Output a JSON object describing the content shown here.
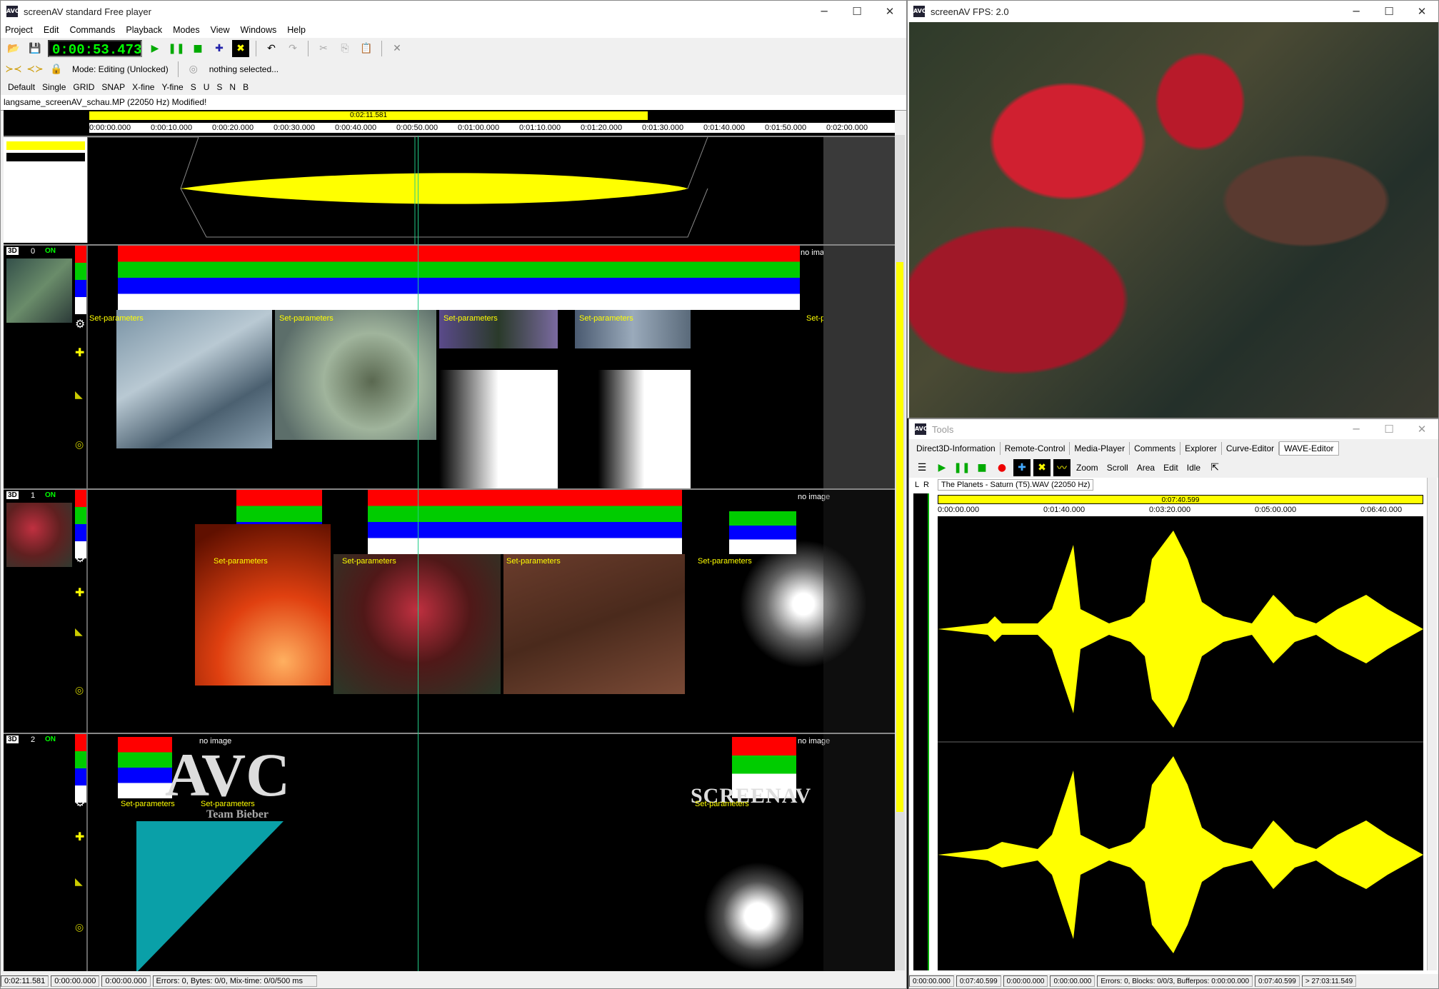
{
  "main": {
    "title": "screenAV standard Free player",
    "menu": [
      "Project",
      "Edit",
      "Commands",
      "Playback",
      "Modes",
      "View",
      "Windows",
      "Help"
    ],
    "timecode": "0:00:53.473",
    "mode": "Mode: Editing (Unlocked)",
    "selection": "nothing selected...",
    "opts": [
      "Default",
      "Single",
      "GRID",
      "SNAP",
      "X-fine",
      "Y-fine",
      "S",
      "U",
      "S",
      "N",
      "B"
    ],
    "file_tab": "langsame_screenAV_schau.MP  (22050 Hz) Modified!",
    "range_label": "0:02:11.581",
    "ruler": [
      "0:00:00.000",
      "0:00:10.000",
      "0:00:20.000",
      "0:00:30.000",
      "0:00:40.000",
      "0:00:50.000",
      "0:01:00.000",
      "0:01:10.000",
      "0:01:20.000",
      "0:01:30.000",
      "0:01:40.000",
      "0:01:50.000",
      "0:02:00.000"
    ],
    "lanes": [
      {
        "badge": "3D",
        "num": "0",
        "on": "ON"
      },
      {
        "badge": "3D",
        "num": "1",
        "on": "ON"
      },
      {
        "badge": "3D",
        "num": "2",
        "on": "ON"
      }
    ],
    "set_params": "Set-parameters",
    "no_image": "no image",
    "logo_text": "AVC",
    "logo_sub": "Team Bieber",
    "screenav_text": "SCREENAV",
    "status": [
      "0:02:11.581",
      "0:00:00.000",
      "0:00:00.000",
      "Errors: 0, Bytes: 0/0, Mix-time: 0/0/500 ms"
    ]
  },
  "preview": {
    "title": "screenAV  FPS: 2.0"
  },
  "tools": {
    "title": "Tools",
    "tabs": [
      "Direct3D-Information",
      "Remote-Control",
      "Media-Player",
      "Comments",
      "Explorer",
      "Curve-Editor",
      "WAVE-Editor"
    ],
    "actions": [
      "Zoom",
      "Scroll",
      "Area",
      "Edit",
      "Idle"
    ],
    "channels": [
      "L",
      "R"
    ],
    "wave_file": "The Planets - Saturn (T5).WAV  (22050 Hz)",
    "range_label": "0:07:40.599",
    "ruler": [
      "0:00:00.000",
      "0:01:40.000",
      "0:03:20.000",
      "0:05:00.000",
      "0:06:40.000"
    ],
    "status": [
      "0:00:00.000",
      "0:07:40.599",
      "0:00:00.000",
      "0:00:00.000",
      "Errors: 0, Blocks: 0/0/3, Bufferpos: 0:00:00.000",
      "0:07:40.599",
      "> 27:03:11.549"
    ]
  }
}
